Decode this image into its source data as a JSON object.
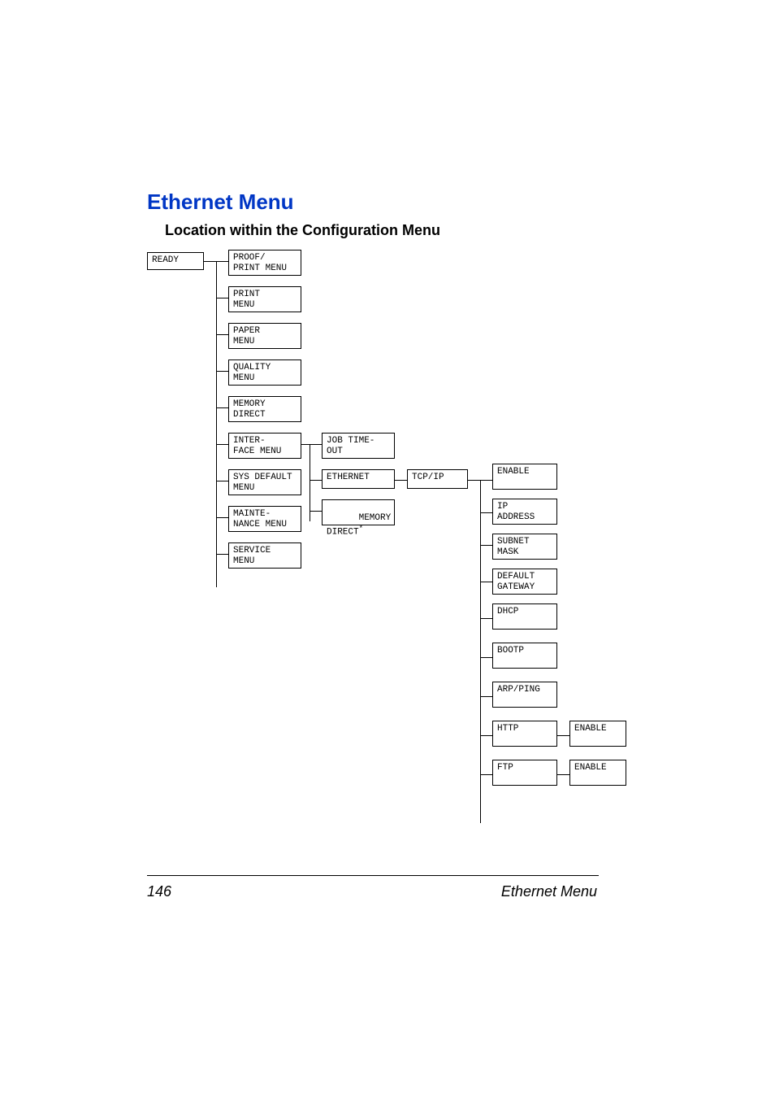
{
  "title": "Ethernet Menu",
  "subtitle": "Location within the Configuration Menu",
  "footer": {
    "page": "146",
    "section": "Ethernet Menu"
  },
  "nodes": {
    "ready": "READY",
    "col1": {
      "proof": "PROOF/\nPRINT MENU",
      "print": "PRINT\nMENU",
      "paper": "PAPER\nMENU",
      "quality": "QUALITY\nMENU",
      "memory": "MEMORY\nDIRECT",
      "interface": "INTER-\nFACE MENU",
      "sysdefault": "SYS DEFAULT\nMENU",
      "maint": "MAINTE-\nNANCE MENU",
      "service": "SERVICE\nMENU"
    },
    "col2": {
      "jobtimeout": "JOB TIME-\nOUT",
      "ethernet": "ETHERNET",
      "memorydirect": "MEMORY\nDIRECT"
    },
    "col3": {
      "tcpip": "TCP/IP"
    },
    "col4": {
      "enable": "ENABLE",
      "ipaddress": "IP\nADDRESS",
      "subnet": "SUBNET\nMASK",
      "gateway": "DEFAULT\nGATEWAY",
      "dhcp": "DHCP",
      "bootp": "BOOTP",
      "arpping": "ARP/PING",
      "http": "HTTP",
      "ftp": "FTP"
    },
    "col5": {
      "httpenable": "ENABLE",
      "ftpenable": "ENABLE"
    },
    "asterisk": "*"
  }
}
